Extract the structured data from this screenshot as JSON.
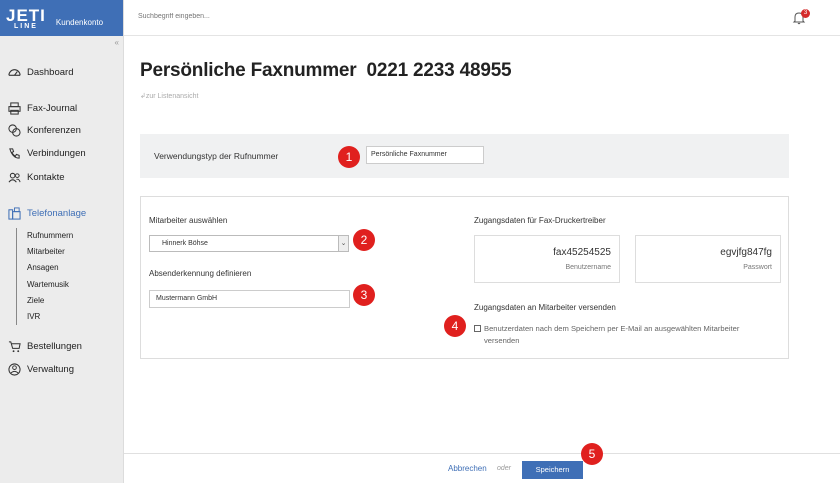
{
  "brand": {
    "logo_main": "JETI",
    "logo_sub": "LINE",
    "portal": "Kundenkonto",
    "color": "#3f6fb6"
  },
  "topbar": {
    "search_placeholder": "Suchbegriff eingeben...",
    "notification_count": "3"
  },
  "sidebar": {
    "collapse": "«",
    "items": [
      {
        "label": "Dashboard",
        "icon": "dashboard-icon"
      },
      {
        "label": "Fax-Journal",
        "icon": "printer-icon"
      },
      {
        "label": "Konferenzen",
        "icon": "conference-icon"
      },
      {
        "label": "Verbindungen",
        "icon": "phone-icon"
      },
      {
        "label": "Kontakte",
        "icon": "contacts-icon"
      },
      {
        "label": "Telefonanlage",
        "icon": "fax-machine-icon"
      },
      {
        "label": "Bestellungen",
        "icon": "cart-icon"
      },
      {
        "label": "Verwaltung",
        "icon": "user-icon"
      }
    ],
    "subitems": [
      "Rufnummern",
      "Mitarbeiter",
      "Ansagen",
      "Wartemusik",
      "Ziele",
      "IVR"
    ]
  },
  "page": {
    "title": "Persönliche Faxnummer",
    "number": "0221 2233 48955",
    "back_link": "zur Listenansicht"
  },
  "usage": {
    "label": "Verwendungstyp der Rufnummer",
    "value": "Persönliche Faxnummer"
  },
  "form": {
    "employee_label": "Mitarbeiter auswählen",
    "employee_value": "Hinnerk Böhse",
    "sender_label": "Absenderkennung definieren",
    "sender_value": "Mustermann GmbH",
    "credentials_label": "Zugangsdaten für Fax-Druckertreiber",
    "username_value": "fax45254525",
    "username_caption": "Benutzername",
    "password_value": "egvjfg847fg",
    "password_caption": "Passwort",
    "send_label": "Zugangsdaten an Mitarbeiter versenden",
    "checkbox_text": "Benutzerdaten nach dem Speichern per E-Mail an ausgewählten Mitarbeiter versenden"
  },
  "footer": {
    "cancel": "Abbrechen",
    "or": "oder",
    "save": "Speichern"
  },
  "markers": [
    "1",
    "2",
    "3",
    "4",
    "5"
  ]
}
